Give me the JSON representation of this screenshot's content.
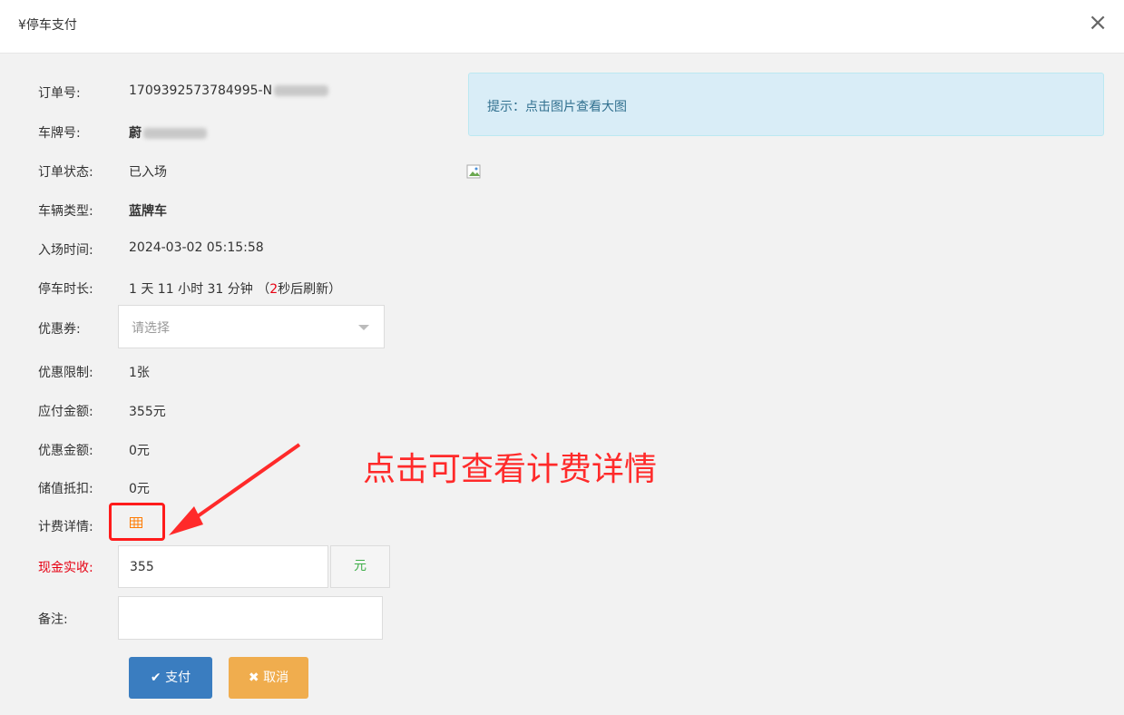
{
  "dialog": {
    "title": "¥停车支付",
    "close_icon": "×"
  },
  "fields": {
    "order_no": {
      "label": "订单号:",
      "value": "1709392573784995-N"
    },
    "plate_no": {
      "label": "车牌号:",
      "value": "蔚"
    },
    "status": {
      "label": "订单状态:",
      "value": "已入场"
    },
    "vehicle_type": {
      "label": "车辆类型:",
      "value": "蓝牌车"
    },
    "entry_time": {
      "label": "入场时间:",
      "value": "2024-03-02 05:15:58"
    },
    "duration": {
      "label": "停车时长:",
      "value": "1 天 11 小时 31 分钟",
      "refresh_prefix": "（",
      "refresh_num": "2",
      "refresh_suffix": "秒后刷新）"
    },
    "coupon": {
      "label": "优惠券:",
      "placeholder": "请选择"
    },
    "coupon_limit": {
      "label": "优惠限制:",
      "value": "1张"
    },
    "payable": {
      "label": "应付金额:",
      "value": "355元"
    },
    "discount": {
      "label": "优惠金额:",
      "value": "0元"
    },
    "stored_value": {
      "label": "储值抵扣:",
      "value": "0元"
    },
    "fee_detail": {
      "label": "计费详情:",
      "icon": "table-icon"
    },
    "cash_received": {
      "label": "现金实收:",
      "value": "355",
      "unit": "元"
    },
    "remark": {
      "label": "备注:",
      "value": ""
    }
  },
  "buttons": {
    "pay": "✔ 支付",
    "cancel": "✖ 取消"
  },
  "tip": {
    "text": "提示：点击图片查看大图"
  },
  "annotation": {
    "text": "点击可查看计费详情",
    "color": "#ff2a2a"
  },
  "colors": {
    "pay_button": "#3a7dc0",
    "cancel_button": "#f0ad4e",
    "tip_bg": "#d9edf7",
    "required_label": "#e60012"
  }
}
